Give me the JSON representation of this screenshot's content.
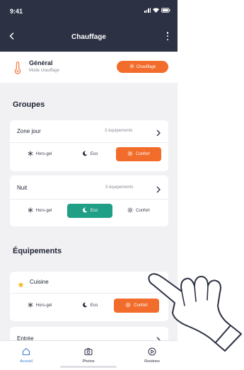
{
  "status": {
    "time": "9:41"
  },
  "header": {
    "title": "Chauffage"
  },
  "general": {
    "title": "Général",
    "subtitle": "Mode chauffage",
    "mode_button": "Chauffage"
  },
  "groups": {
    "title": "Groupes",
    "items": [
      {
        "name": "Zone jour",
        "count": "3 équipements",
        "modes": [
          "Hors-gel",
          "Eco",
          "Confort"
        ],
        "active": "Confort"
      },
      {
        "name": "Nuit",
        "count": "3 équipements",
        "modes": [
          "Hors-gel",
          "Eco",
          "Confort"
        ],
        "active": "Eco"
      }
    ]
  },
  "equipments": {
    "title": "Équipements",
    "items": [
      {
        "name": "Cuisine",
        "favorite": true,
        "modes": [
          "Hors-gel",
          "Eco",
          "Confort"
        ],
        "active": "Confort"
      },
      {
        "name": "Entrée"
      }
    ]
  },
  "tabbar": {
    "items": [
      {
        "label": "Accueil",
        "icon": "home-icon"
      },
      {
        "label": "Photos",
        "icon": "camera-icon"
      },
      {
        "label": "Routines",
        "icon": "play-icon"
      }
    ],
    "active": "Accueil"
  },
  "colors": {
    "header": "#2c3143",
    "accent_orange": "#f26c2b",
    "accent_green": "#1f9f86",
    "tab_active": "#3a7bd5"
  }
}
